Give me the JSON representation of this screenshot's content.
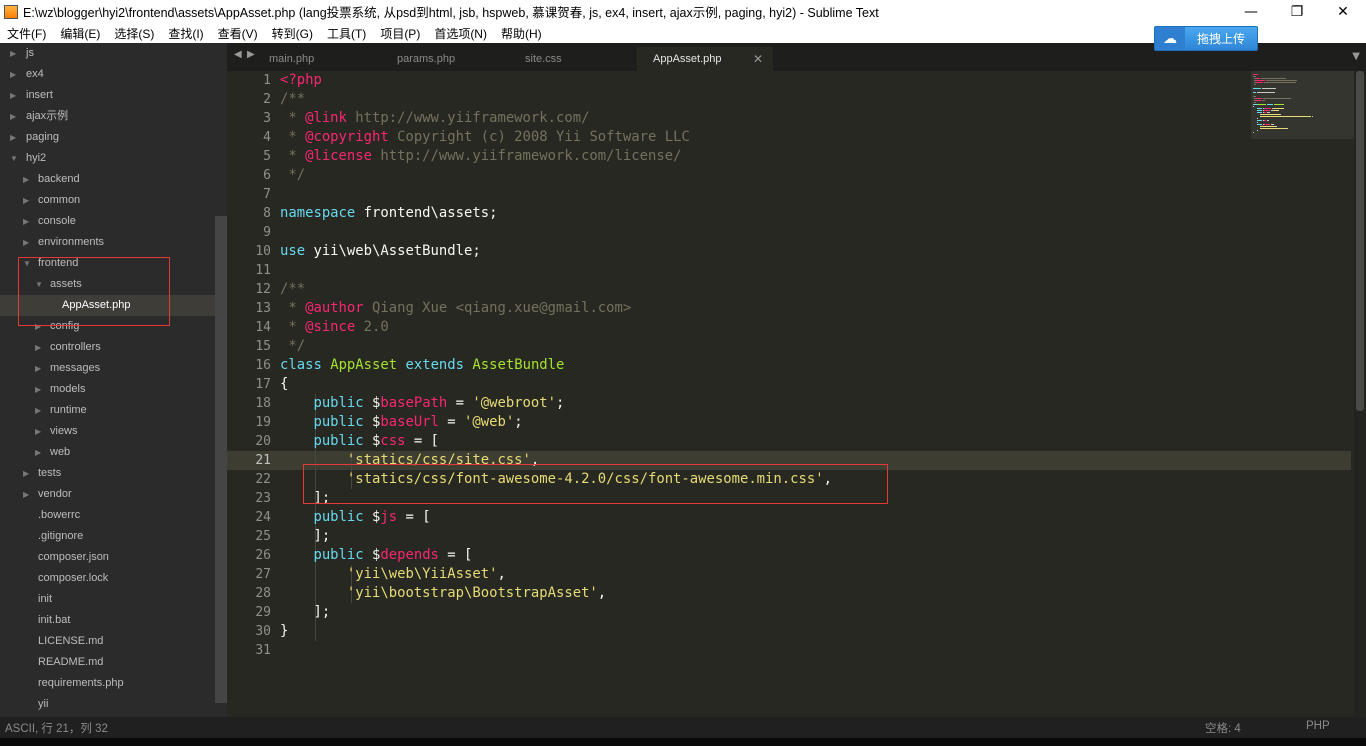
{
  "window": {
    "title": "E:\\wz\\blogger\\hyi2\\frontend\\assets\\AppAsset.php (lang投票系统, 从psd到html, jsb, hspweb, 慕课贺春, js, ex4, insert, ajax示例, paging, hyi2) - Sublime Text",
    "minimize": "—",
    "restore": "❐",
    "close": "✕"
  },
  "menu": [
    "文件(F)",
    "编辑(E)",
    "选择(S)",
    "查找(I)",
    "查看(V)",
    "转到(G)",
    "工具(T)",
    "项目(P)",
    "首选项(N)",
    "帮助(H)"
  ],
  "upload_button": {
    "label": "拖拽上传",
    "icon": "cloud-icon"
  },
  "sidebar": {
    "items": [
      {
        "label": "js",
        "indent": 0,
        "expanded": false
      },
      {
        "label": "ex4",
        "indent": 0,
        "expanded": false
      },
      {
        "label": "insert",
        "indent": 0,
        "expanded": false
      },
      {
        "label": "ajax示例",
        "indent": 0,
        "expanded": false
      },
      {
        "label": "paging",
        "indent": 0,
        "expanded": false
      },
      {
        "label": "hyi2",
        "indent": 0,
        "expanded": true
      },
      {
        "label": "backend",
        "indent": 1,
        "expanded": false
      },
      {
        "label": "common",
        "indent": 1,
        "expanded": false
      },
      {
        "label": "console",
        "indent": 1,
        "expanded": false
      },
      {
        "label": "environments",
        "indent": 1,
        "expanded": false
      },
      {
        "label": "frontend",
        "indent": 1,
        "expanded": true
      },
      {
        "label": "assets",
        "indent": 2,
        "expanded": true
      },
      {
        "label": "AppAsset.php",
        "indent": 3,
        "file": true,
        "selected": true
      },
      {
        "label": "config",
        "indent": 2,
        "expanded": false
      },
      {
        "label": "controllers",
        "indent": 2,
        "expanded": false
      },
      {
        "label": "messages",
        "indent": 2,
        "expanded": false
      },
      {
        "label": "models",
        "indent": 2,
        "expanded": false
      },
      {
        "label": "runtime",
        "indent": 2,
        "expanded": false
      },
      {
        "label": "views",
        "indent": 2,
        "expanded": false
      },
      {
        "label": "web",
        "indent": 2,
        "expanded": false
      },
      {
        "label": "tests",
        "indent": 1,
        "expanded": false
      },
      {
        "label": "vendor",
        "indent": 1,
        "expanded": false
      },
      {
        "label": ".bowerrc",
        "indent": 1,
        "file": true
      },
      {
        "label": ".gitignore",
        "indent": 1,
        "file": true
      },
      {
        "label": "composer.json",
        "indent": 1,
        "file": true
      },
      {
        "label": "composer.lock",
        "indent": 1,
        "file": true
      },
      {
        "label": "init",
        "indent": 1,
        "file": true
      },
      {
        "label": "init.bat",
        "indent": 1,
        "file": true
      },
      {
        "label": "LICENSE.md",
        "indent": 1,
        "file": true
      },
      {
        "label": "README.md",
        "indent": 1,
        "file": true
      },
      {
        "label": "requirements.php",
        "indent": 1,
        "file": true
      },
      {
        "label": "yii",
        "indent": 1,
        "file": true
      }
    ]
  },
  "tabs": [
    {
      "label": "main.php",
      "active": false
    },
    {
      "label": "params.php",
      "active": false
    },
    {
      "label": "site.css",
      "active": false
    },
    {
      "label": "AppAsset.php",
      "active": true
    }
  ],
  "editor": {
    "current_line": 21,
    "lines": [
      [
        [
          "php",
          "<?php"
        ]
      ],
      [
        [
          "comment",
          "/**"
        ]
      ],
      [
        [
          "comment",
          " * "
        ],
        [
          "tag",
          "@link"
        ],
        [
          "comment",
          " http://www.yiiframework.com/"
        ]
      ],
      [
        [
          "comment",
          " * "
        ],
        [
          "tag",
          "@copyright"
        ],
        [
          "comment",
          " Copyright (c) 2008 Yii Software LLC"
        ]
      ],
      [
        [
          "comment",
          " * "
        ],
        [
          "tag",
          "@license"
        ],
        [
          "comment",
          " http://www.yiiframework.com/license/"
        ]
      ],
      [
        [
          "comment",
          " */"
        ]
      ],
      [],
      [
        [
          "kw",
          "namespace"
        ],
        [
          "plain",
          " frontend\\assets;"
        ]
      ],
      [],
      [
        [
          "kw",
          "use"
        ],
        [
          "plain",
          " yii\\web\\AssetBundle;"
        ]
      ],
      [],
      [
        [
          "comment",
          "/**"
        ]
      ],
      [
        [
          "comment",
          " * "
        ],
        [
          "tag",
          "@author"
        ],
        [
          "comment",
          " Qiang Xue <qiang.xue@gmail.com>"
        ]
      ],
      [
        [
          "comment",
          " * "
        ],
        [
          "tag",
          "@since"
        ],
        [
          "comment",
          " 2.0"
        ]
      ],
      [
        [
          "comment",
          " */"
        ]
      ],
      [
        [
          "kw",
          "class"
        ],
        [
          "plain",
          " "
        ],
        [
          "class",
          "AppAsset"
        ],
        [
          "plain",
          " "
        ],
        [
          "kw",
          "extends"
        ],
        [
          "plain",
          " "
        ],
        [
          "class",
          "AssetBundle"
        ]
      ],
      [
        [
          "plain",
          "{"
        ]
      ],
      [
        [
          "plain",
          "    "
        ],
        [
          "kw",
          "public"
        ],
        [
          "plain",
          " $"
        ],
        [
          "var",
          "basePath"
        ],
        [
          "plain",
          " = "
        ],
        [
          "str",
          "'@webroot'"
        ],
        [
          "plain",
          ";"
        ]
      ],
      [
        [
          "plain",
          "    "
        ],
        [
          "kw",
          "public"
        ],
        [
          "plain",
          " $"
        ],
        [
          "var",
          "baseUrl"
        ],
        [
          "plain",
          " = "
        ],
        [
          "str",
          "'@web'"
        ],
        [
          "plain",
          ";"
        ]
      ],
      [
        [
          "plain",
          "    "
        ],
        [
          "kw",
          "public"
        ],
        [
          "plain",
          " $"
        ],
        [
          "var",
          "css"
        ],
        [
          "plain",
          " = ["
        ]
      ],
      [
        [
          "plain",
          "        "
        ],
        [
          "str",
          "'statics/css/site.css'"
        ],
        [
          "plain",
          ","
        ]
      ],
      [
        [
          "plain",
          "        "
        ],
        [
          "str",
          "'statics/css/font-awesome-4.2.0/css/font-awesome.min.css'"
        ],
        [
          "plain",
          ","
        ]
      ],
      [
        [
          "plain",
          "    ];"
        ]
      ],
      [
        [
          "plain",
          "    "
        ],
        [
          "kw",
          "public"
        ],
        [
          "plain",
          " $"
        ],
        [
          "var",
          "js"
        ],
        [
          "plain",
          " = ["
        ]
      ],
      [
        [
          "plain",
          "    ];"
        ]
      ],
      [
        [
          "plain",
          "    "
        ],
        [
          "kw",
          "public"
        ],
        [
          "plain",
          " $"
        ],
        [
          "var",
          "depends"
        ],
        [
          "plain",
          " = ["
        ]
      ],
      [
        [
          "plain",
          "        "
        ],
        [
          "str",
          "'yii\\web\\YiiAsset'"
        ],
        [
          "plain",
          ","
        ]
      ],
      [
        [
          "plain",
          "        "
        ],
        [
          "str",
          "'yii\\bootstrap\\BootstrapAsset'"
        ],
        [
          "plain",
          ","
        ]
      ],
      [
        [
          "plain",
          "    ];"
        ]
      ],
      [
        [
          "plain",
          "}"
        ]
      ],
      []
    ]
  },
  "status": {
    "left": "ASCII, 行 21，列 32",
    "indent": "空格: 4",
    "syntax": "PHP"
  },
  "colors": {
    "editor_bg": "#272822",
    "sidebar_bg": "#2b2b2b",
    "annotation_red": "#e53935",
    "upload_blue": "#2f86d6"
  }
}
